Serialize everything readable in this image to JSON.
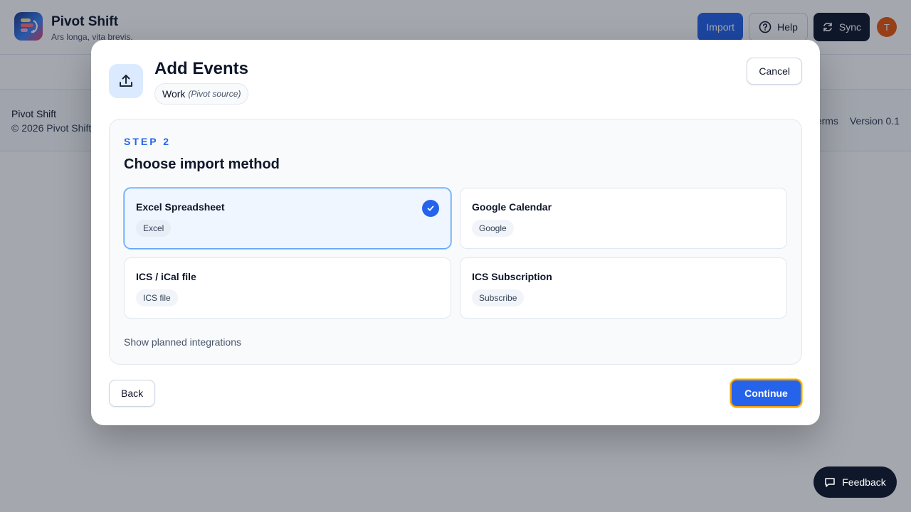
{
  "app": {
    "title": "Pivot Shift",
    "tagline": "Ars longa, vita brevis.",
    "avatar_initial": "T"
  },
  "header": {
    "import_label": "Import",
    "help_label": "Help",
    "sync_label": "Sync"
  },
  "footer": {
    "name": "Pivot Shift",
    "copyright": "© 2026 Pivot Shift",
    "links": [
      "Terms",
      "Version 0.1"
    ]
  },
  "modal": {
    "title": "Add Events",
    "source_name": "Work",
    "source_note": "(Pivot source)",
    "cancel_label": "Cancel",
    "step_label": "STEP 2",
    "step_heading": "Choose import method",
    "options": [
      {
        "title": "Excel Spreadsheet",
        "tag": "Excel",
        "selected": true
      },
      {
        "title": "Google Calendar",
        "tag": "Google",
        "selected": false
      },
      {
        "title": "ICS / iCal file",
        "tag": "ICS file",
        "selected": false
      },
      {
        "title": "ICS Subscription",
        "tag": "Subscribe",
        "selected": false
      }
    ],
    "show_planned_label": "Show planned integrations",
    "back_label": "Back",
    "continue_label": "Continue"
  },
  "feedback_label": "Feedback",
  "colors": {
    "accent": "#2563eb",
    "dark": "#0f172a",
    "avatar": "#ea580c",
    "focus_ring": "#f59e0b"
  },
  "icons": {
    "logo": "pivot-logo-icon",
    "help": "question-circle-icon",
    "sync": "refresh-icon",
    "upload": "upload-icon",
    "check": "check-icon",
    "feedback": "chat-bubble-icon"
  }
}
